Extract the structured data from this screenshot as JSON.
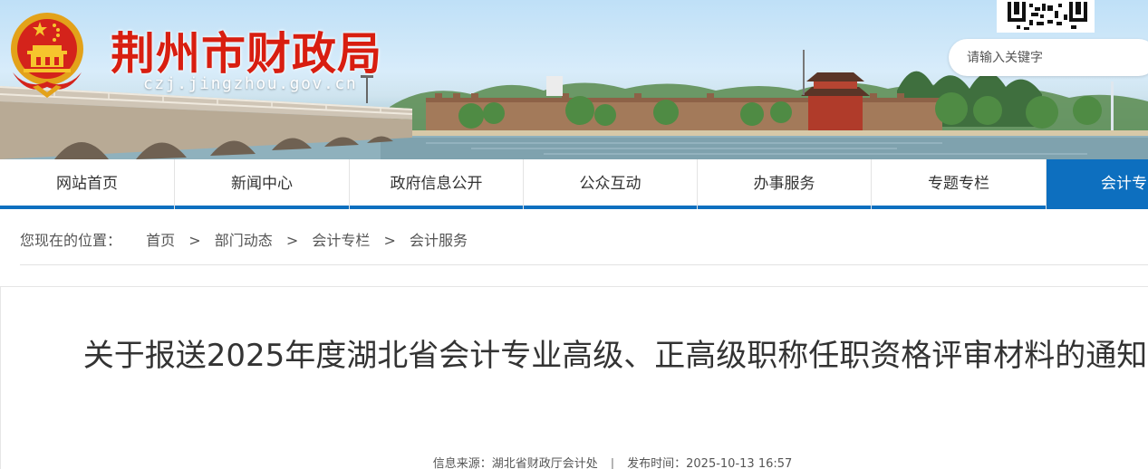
{
  "header": {
    "site_title": "荆州市财政局",
    "site_url": "czj.jingzhou.gov.cn",
    "search_placeholder": "请输入关键字",
    "colors": {
      "title_red": "#d81e10",
      "nav_blue": "#0d6fbf"
    }
  },
  "nav": {
    "items": [
      {
        "label": "网站首页"
      },
      {
        "label": "新闻中心"
      },
      {
        "label": "政府信息公开"
      },
      {
        "label": "公众互动"
      },
      {
        "label": "办事服务"
      },
      {
        "label": "专题专栏"
      },
      {
        "label": "会计专"
      }
    ],
    "active_index": 6
  },
  "breadcrumb": {
    "lead": "您现在的位置：",
    "items": [
      "首页",
      "部门动态",
      "会计专栏",
      "会计服务"
    ],
    "separator": ">"
  },
  "article": {
    "title": "关于报送2025年度湖北省会计专业高级、正高级职称任职资格评审材料的通知",
    "source_label": "信息来源：",
    "source_value": "湖北省财政厅会计处",
    "divider": "|",
    "date_label": "发布时间：",
    "date_value": "2025-10-13 16:57"
  }
}
